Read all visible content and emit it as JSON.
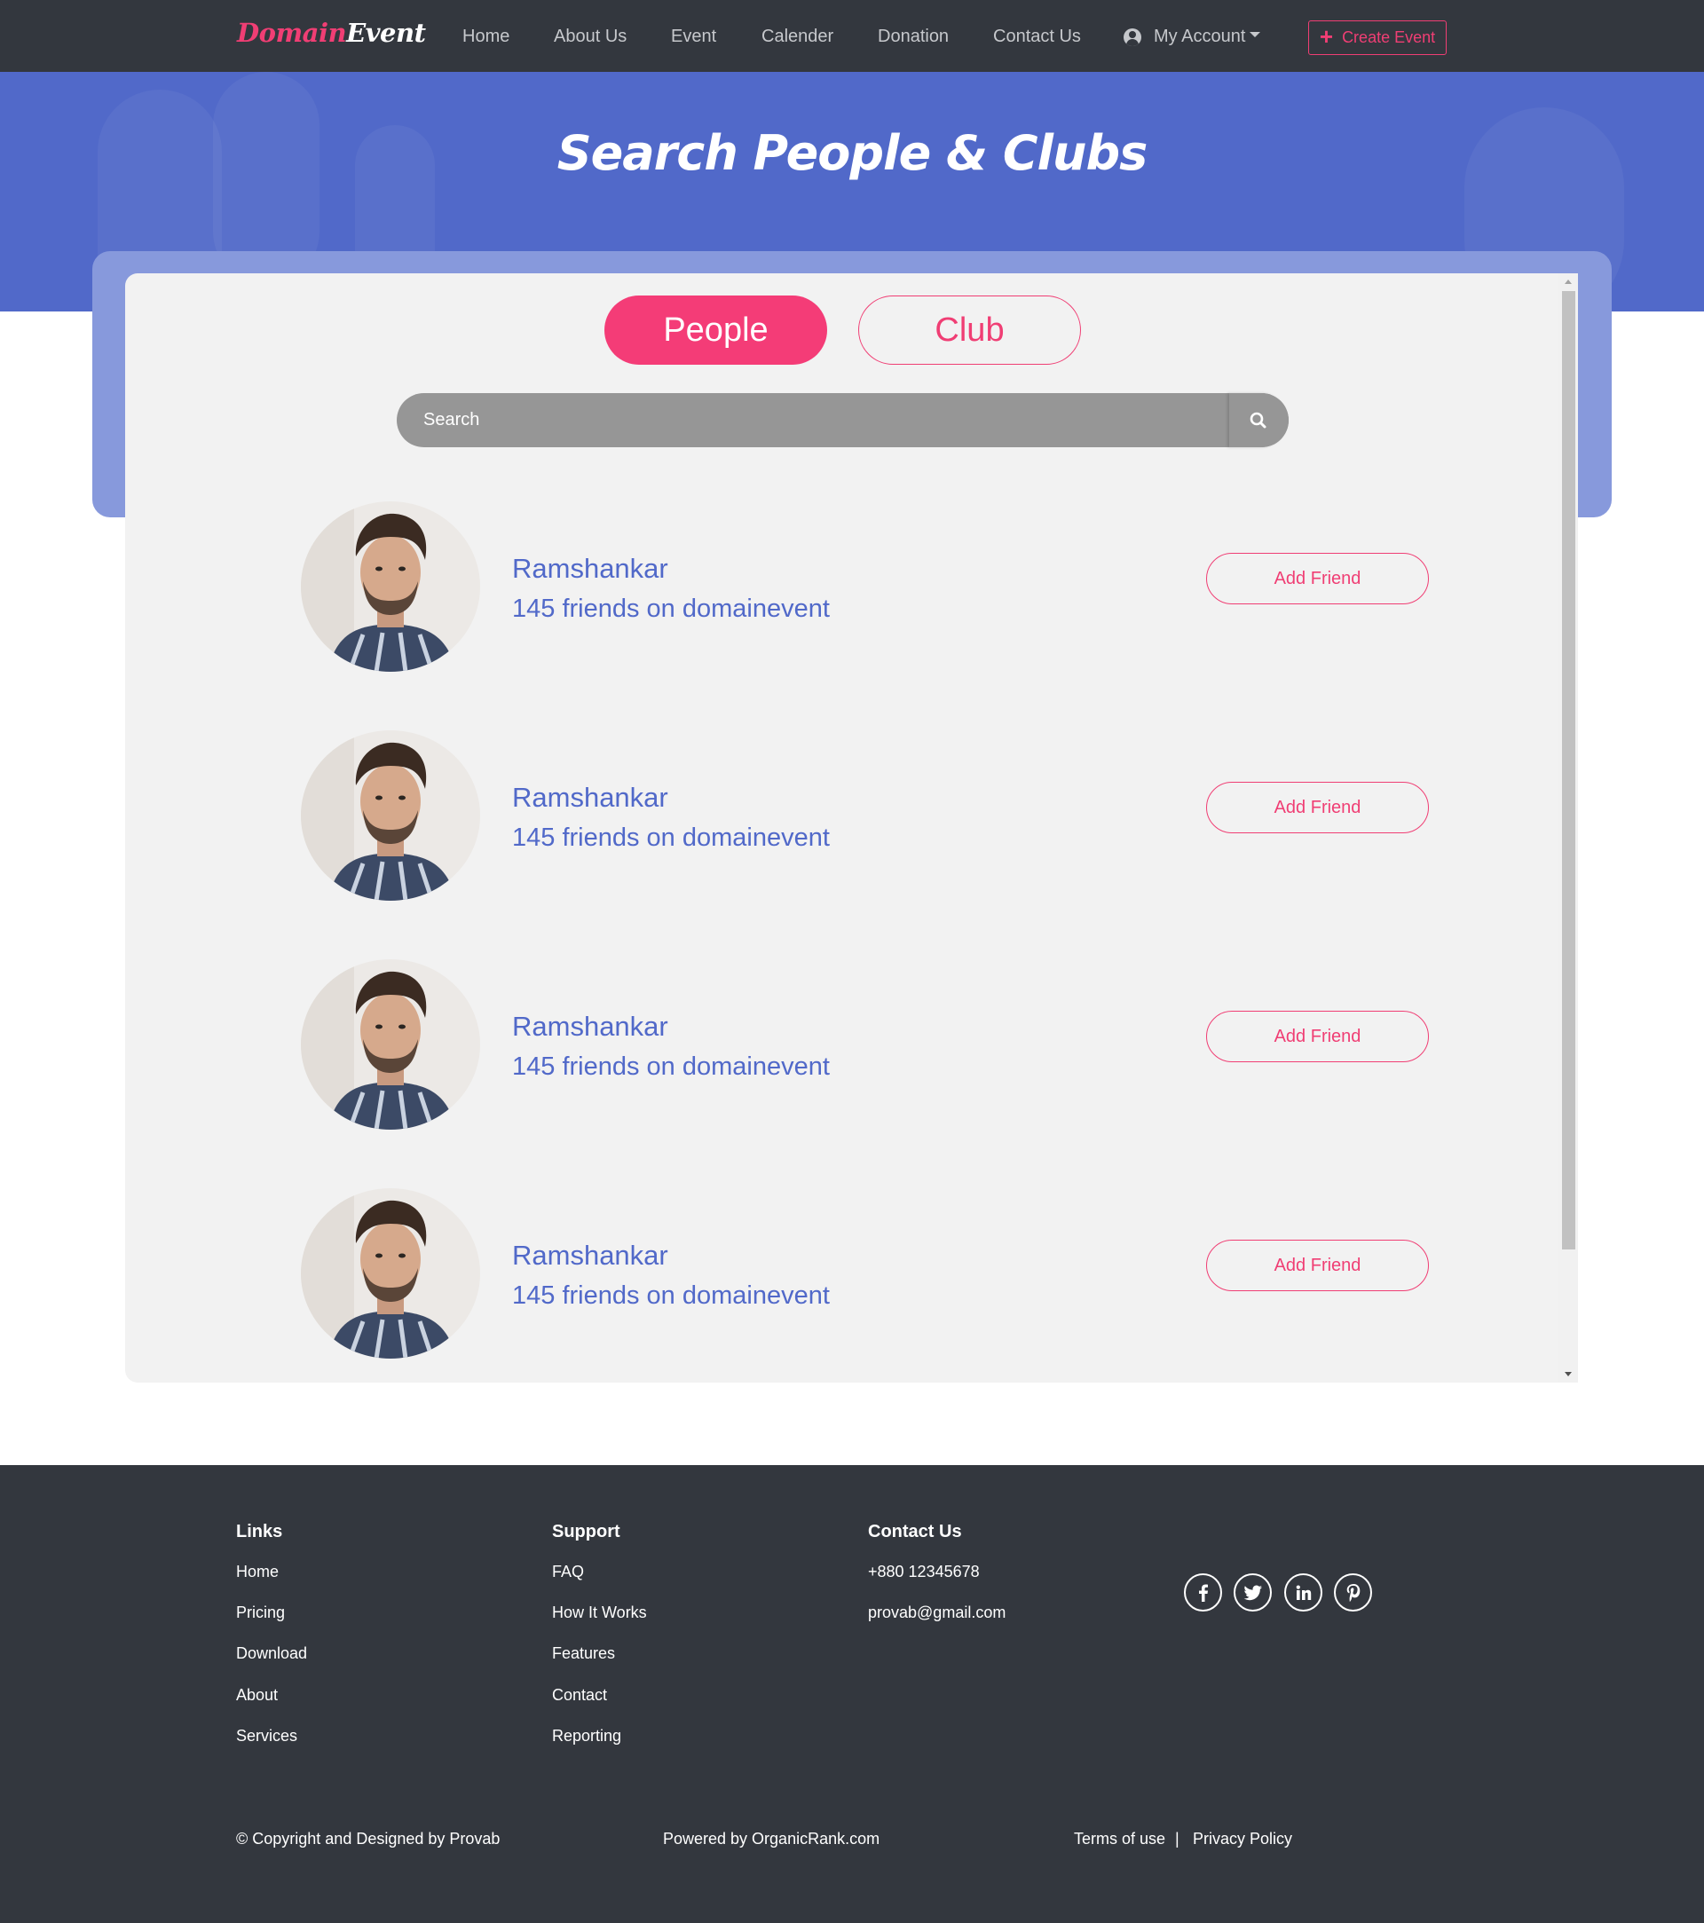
{
  "nav": {
    "brand_part1": "Domain",
    "brand_part2": "Event",
    "links": [
      "Home",
      "About Us",
      "Event",
      "Calender",
      "Donation",
      "Contact Us"
    ],
    "account_label": "My Account",
    "create_event_label": "Create Event"
  },
  "hero": {
    "title": "Search People & Clubs"
  },
  "tabs": {
    "people": "People",
    "club": "Club",
    "active": "People"
  },
  "search": {
    "placeholder": "Search",
    "value": ""
  },
  "people": [
    {
      "name": "Ramshankar",
      "friends": "145 friends on domainevent",
      "action": "Add Friend"
    },
    {
      "name": "Ramshankar",
      "friends": "145 friends on domainevent",
      "action": "Add Friend"
    },
    {
      "name": "Ramshankar",
      "friends": "145 friends on domainevent",
      "action": "Add Friend"
    },
    {
      "name": "Ramshankar",
      "friends": "145 friends on domainevent",
      "action": "Add Friend"
    }
  ],
  "footer": {
    "links": {
      "heading": "Links",
      "items": [
        "Home",
        "Pricing",
        "Download",
        "About",
        "Services"
      ]
    },
    "support": {
      "heading": "Support",
      "items": [
        "FAQ",
        "How It Works",
        "Features",
        "Contact",
        "Reporting"
      ]
    },
    "contact": {
      "heading": "Contact Us",
      "phone": "+880 12345678",
      "email": "provab@gmail.com"
    },
    "social": [
      "facebook-icon",
      "twitter-icon",
      "linkedin-icon",
      "pinterest-icon"
    ],
    "copyright": "© Copyright and Designed by Provab",
    "powered": "Powered by OrganicRank.com",
    "terms": "Terms of use",
    "separator": "|",
    "privacy": "Privacy Policy"
  },
  "colors": {
    "navbar": "#33373e",
    "accent": "#f03e74",
    "hero": "#5169c9",
    "link_blue": "#5169c9",
    "card": "#f2f2f2",
    "search": "#969696"
  }
}
